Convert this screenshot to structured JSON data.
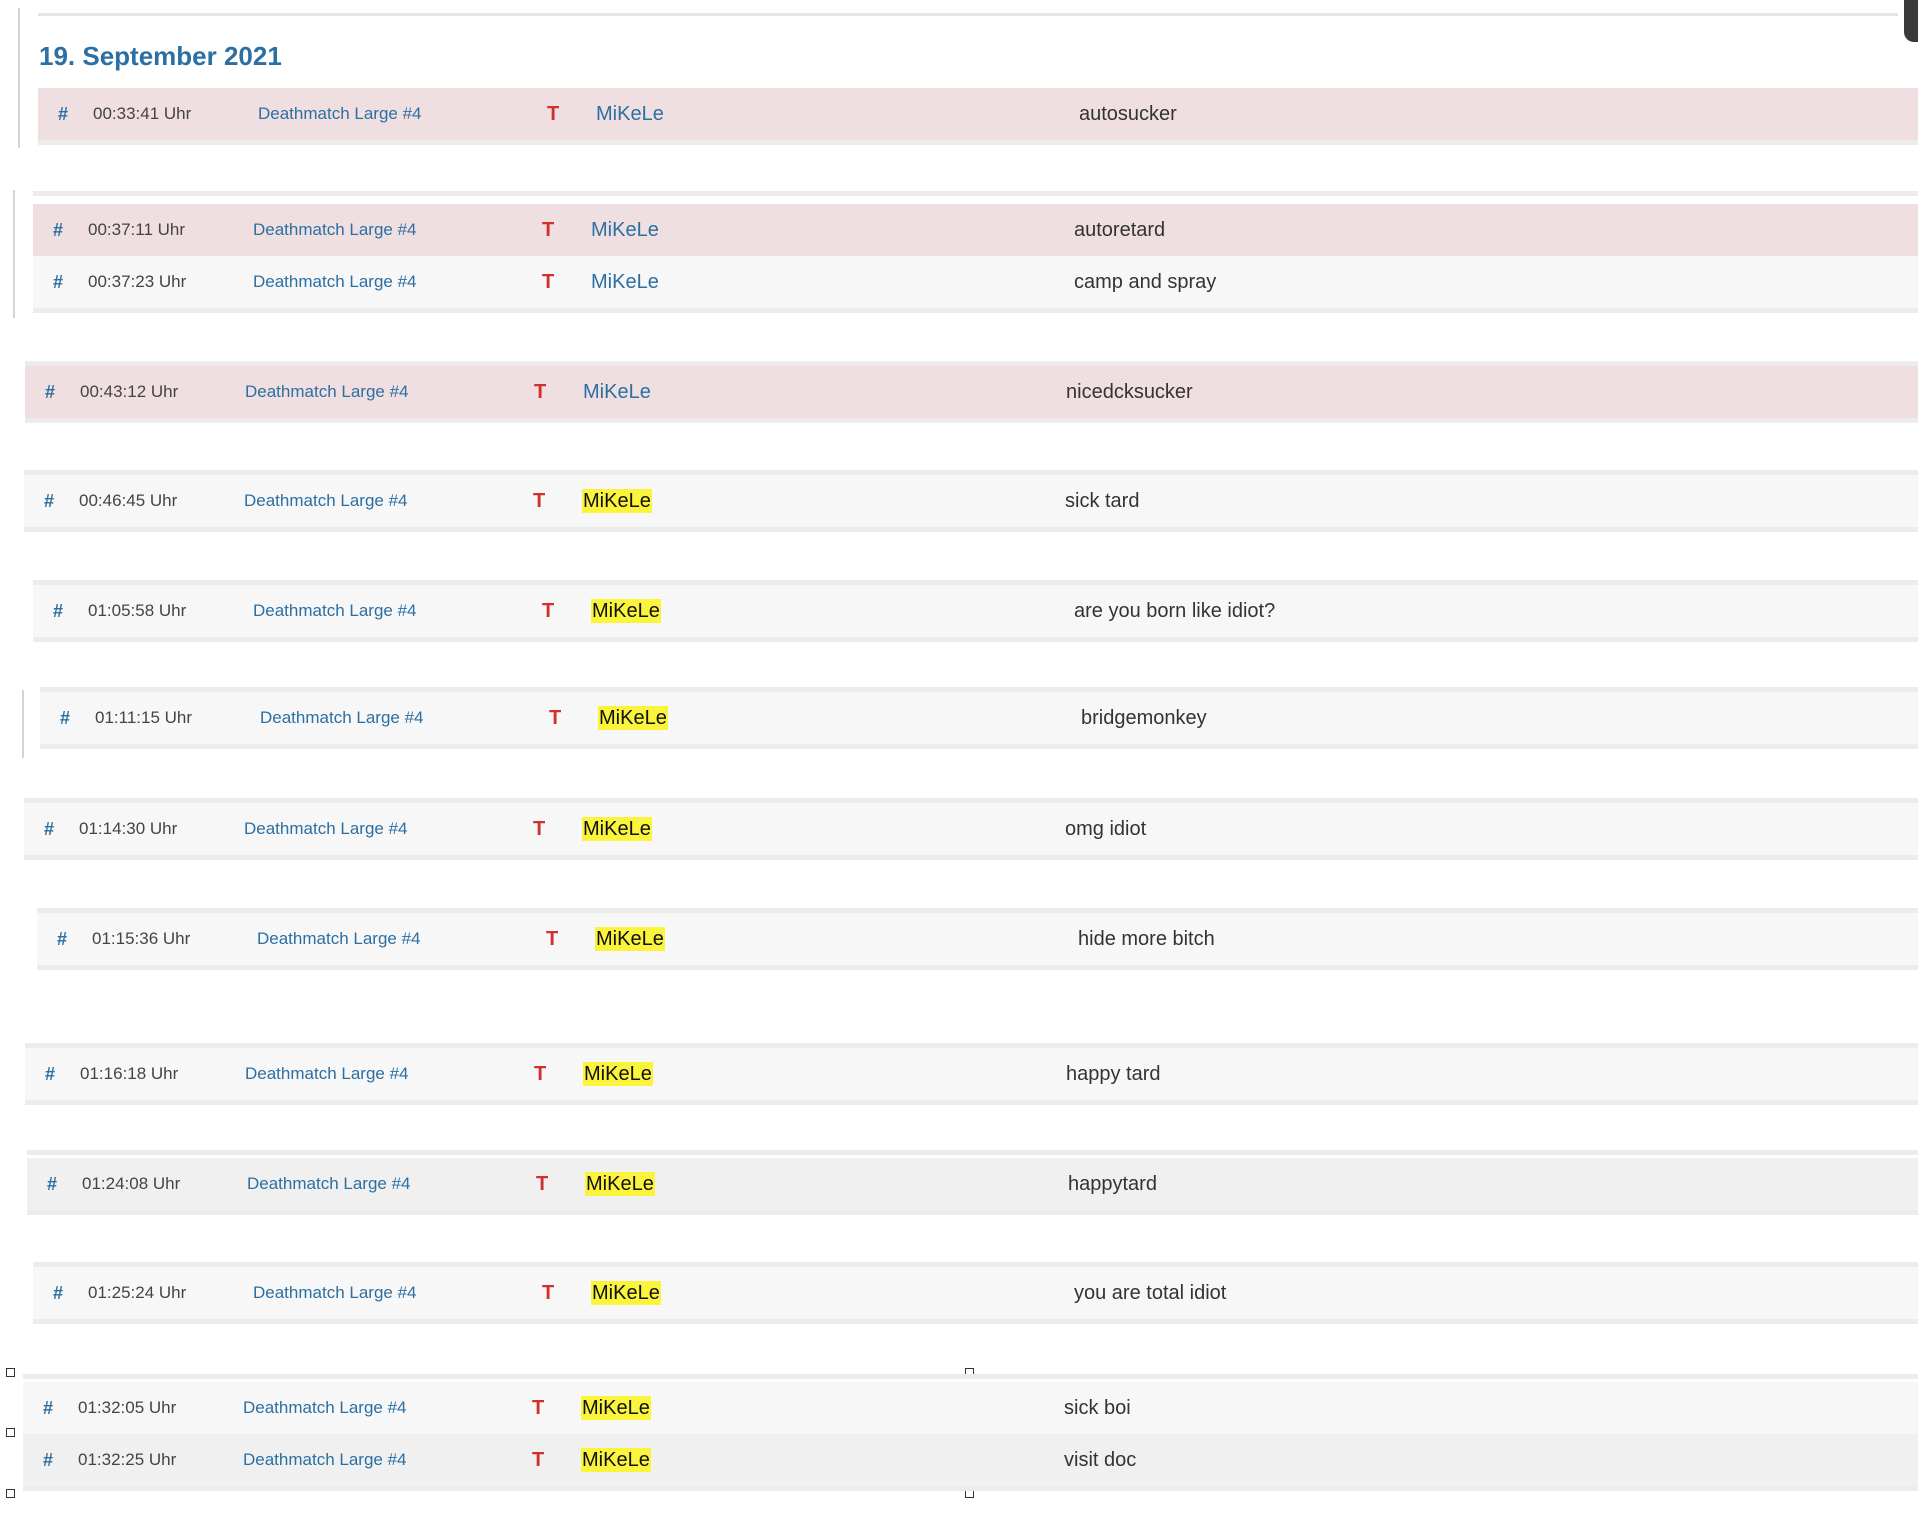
{
  "date_heading": "19. September 2021",
  "colors": {
    "link_blue": "#2b6fa3",
    "team_red": "#d0312d",
    "flag_pink": "#f0dfe0",
    "highlight_yellow": "#fbf43c",
    "row_grey": "#f7f7f7"
  },
  "icons": {
    "row_link": "hash-icon",
    "team": "team-t-icon"
  },
  "rows": [
    {
      "hash": "#",
      "time": "00:33:41 Uhr",
      "server": "Deathmatch Large #4",
      "team": "T",
      "player": "MiKeLe",
      "message": "autosucker"
    },
    {
      "hash": "#",
      "time": "00:37:11 Uhr",
      "server": "Deathmatch Large #4",
      "team": "T",
      "player": "MiKeLe",
      "message": "autoretard"
    },
    {
      "hash": "#",
      "time": "00:37:23 Uhr",
      "server": "Deathmatch Large #4",
      "team": "T",
      "player": "MiKeLe",
      "message": "camp and spray"
    },
    {
      "hash": "#",
      "time": "00:43:12 Uhr",
      "server": "Deathmatch Large #4",
      "team": "T",
      "player": "MiKeLe",
      "message": "nicedcksucker"
    },
    {
      "hash": "#",
      "time": "00:46:45 Uhr",
      "server": "Deathmatch Large #4",
      "team": "T",
      "player": "MiKeLe",
      "message": "sick tard"
    },
    {
      "hash": "#",
      "time": "01:05:58 Uhr",
      "server": "Deathmatch Large #4",
      "team": "T",
      "player": "MiKeLe",
      "message": "are you born like idiot?"
    },
    {
      "hash": "#",
      "time": "01:11:15 Uhr",
      "server": "Deathmatch Large #4",
      "team": "T",
      "player": "MiKeLe",
      "message": "bridgemonkey"
    },
    {
      "hash": "#",
      "time": "01:14:30 Uhr",
      "server": "Deathmatch Large #4",
      "team": "T",
      "player": "MiKeLe",
      "message": "omg idiot"
    },
    {
      "hash": "#",
      "time": "01:15:36 Uhr",
      "server": "Deathmatch Large #4",
      "team": "T",
      "player": "MiKeLe",
      "message": "hide more bitch"
    },
    {
      "hash": "#",
      "time": "01:16:18 Uhr",
      "server": "Deathmatch Large #4",
      "team": "T",
      "player": "MiKeLe",
      "message": "happy tard"
    },
    {
      "hash": "#",
      "time": "01:24:08 Uhr",
      "server": "Deathmatch Large #4",
      "team": "T",
      "player": "MiKeLe",
      "message": "happytard"
    },
    {
      "hash": "#",
      "time": "01:25:24 Uhr",
      "server": "Deathmatch Large #4",
      "team": "T",
      "player": "MiKeLe",
      "message": "you are total idiot"
    },
    {
      "hash": "#",
      "time": "01:32:05 Uhr",
      "server": "Deathmatch Large #4",
      "team": "T",
      "player": "MiKeLe",
      "message": "sick boi"
    },
    {
      "hash": "#",
      "time": "01:32:25 Uhr",
      "server": "Deathmatch Large #4",
      "team": "T",
      "player": "MiKeLe",
      "message": "visit doc"
    }
  ]
}
